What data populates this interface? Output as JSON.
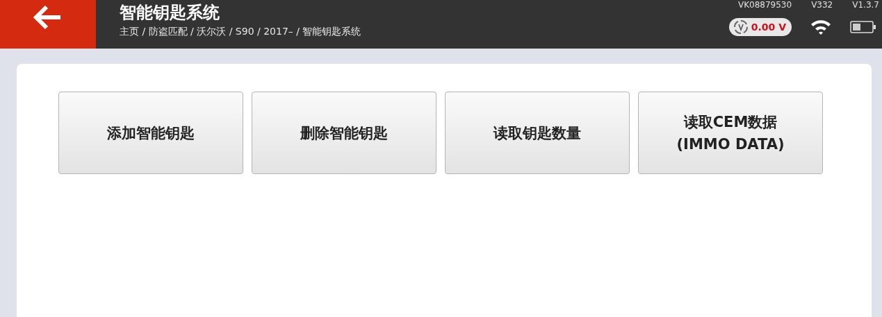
{
  "header": {
    "title": "智能钥匙系统",
    "breadcrumb": "主页 / 防盗匹配 / 沃尔沃 / S90 / 2017– / 智能钥匙系统",
    "device_info": [
      "VK08879530",
      "V332",
      "V1.3.7"
    ],
    "voltage": "0.00 V"
  },
  "buttons": [
    {
      "label": "添加智能钥匙"
    },
    {
      "label": "删除智能钥匙"
    },
    {
      "label": "读取钥匙数量"
    },
    {
      "label": "读取CEM数据\n(IMMO DATA)"
    }
  ]
}
